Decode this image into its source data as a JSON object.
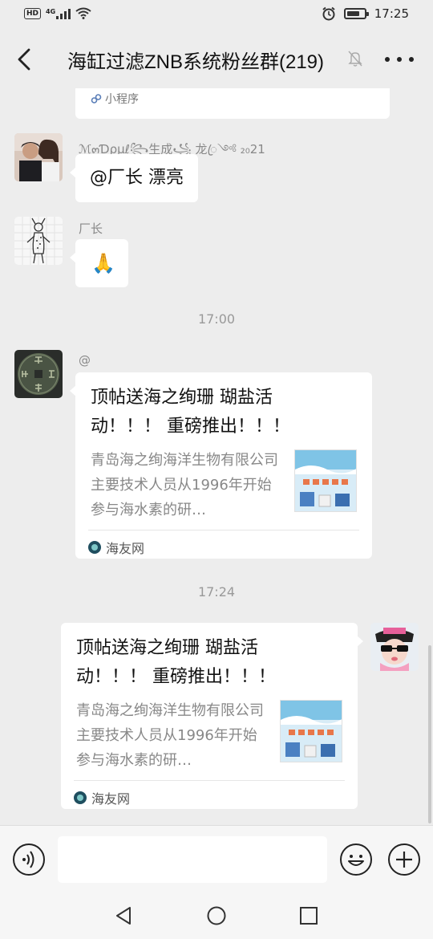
{
  "status_bar": {
    "hd_badge": "HD",
    "network": "4G",
    "time": "17:25",
    "battery_level": 0.75
  },
  "header": {
    "title": "海缸过滤ZNB系统粉丝群(219)",
    "back_icon": "chevron-left-icon",
    "mute_icon": "bell-off-icon",
    "more_icon": "more-dots-icon"
  },
  "chat": {
    "mini_program_label": "小程序",
    "messages": [
      {
        "sender": "ℳ๓Ɗρμℓ꧂生成꧁ 龙ꦿ༺ ₂₀21",
        "text": "@厂长  漂亮"
      },
      {
        "sender": "厂长",
        "text": "🙏"
      }
    ],
    "time_1": "17:00",
    "card_1": {
      "sender": "@",
      "title": "顶帖送海之绚珊 瑚盐活动！！！ 重磅推出！！！",
      "description": "青岛海之绚海洋生物有限公司主要技术人员从1996年开始参与海水素的研…",
      "source": "海友网"
    },
    "time_2": "17:24",
    "card_2": {
      "title": "顶帖送海之绚珊 瑚盐活动！！！ 重磅推出！！！",
      "description": "青岛海之绚海洋生物有限公司主要技术人员从1996年开始参与海水素的研…",
      "source": "海友网"
    }
  },
  "input_bar": {
    "voice_icon": "voice-icon",
    "emoji_icon": "emoji-icon",
    "plus_icon": "plus-circle-icon",
    "placeholder": ""
  },
  "nav_bar": {
    "back_icon": "triangle-back-icon",
    "home_icon": "circle-home-icon",
    "recents_icon": "square-recents-icon"
  }
}
